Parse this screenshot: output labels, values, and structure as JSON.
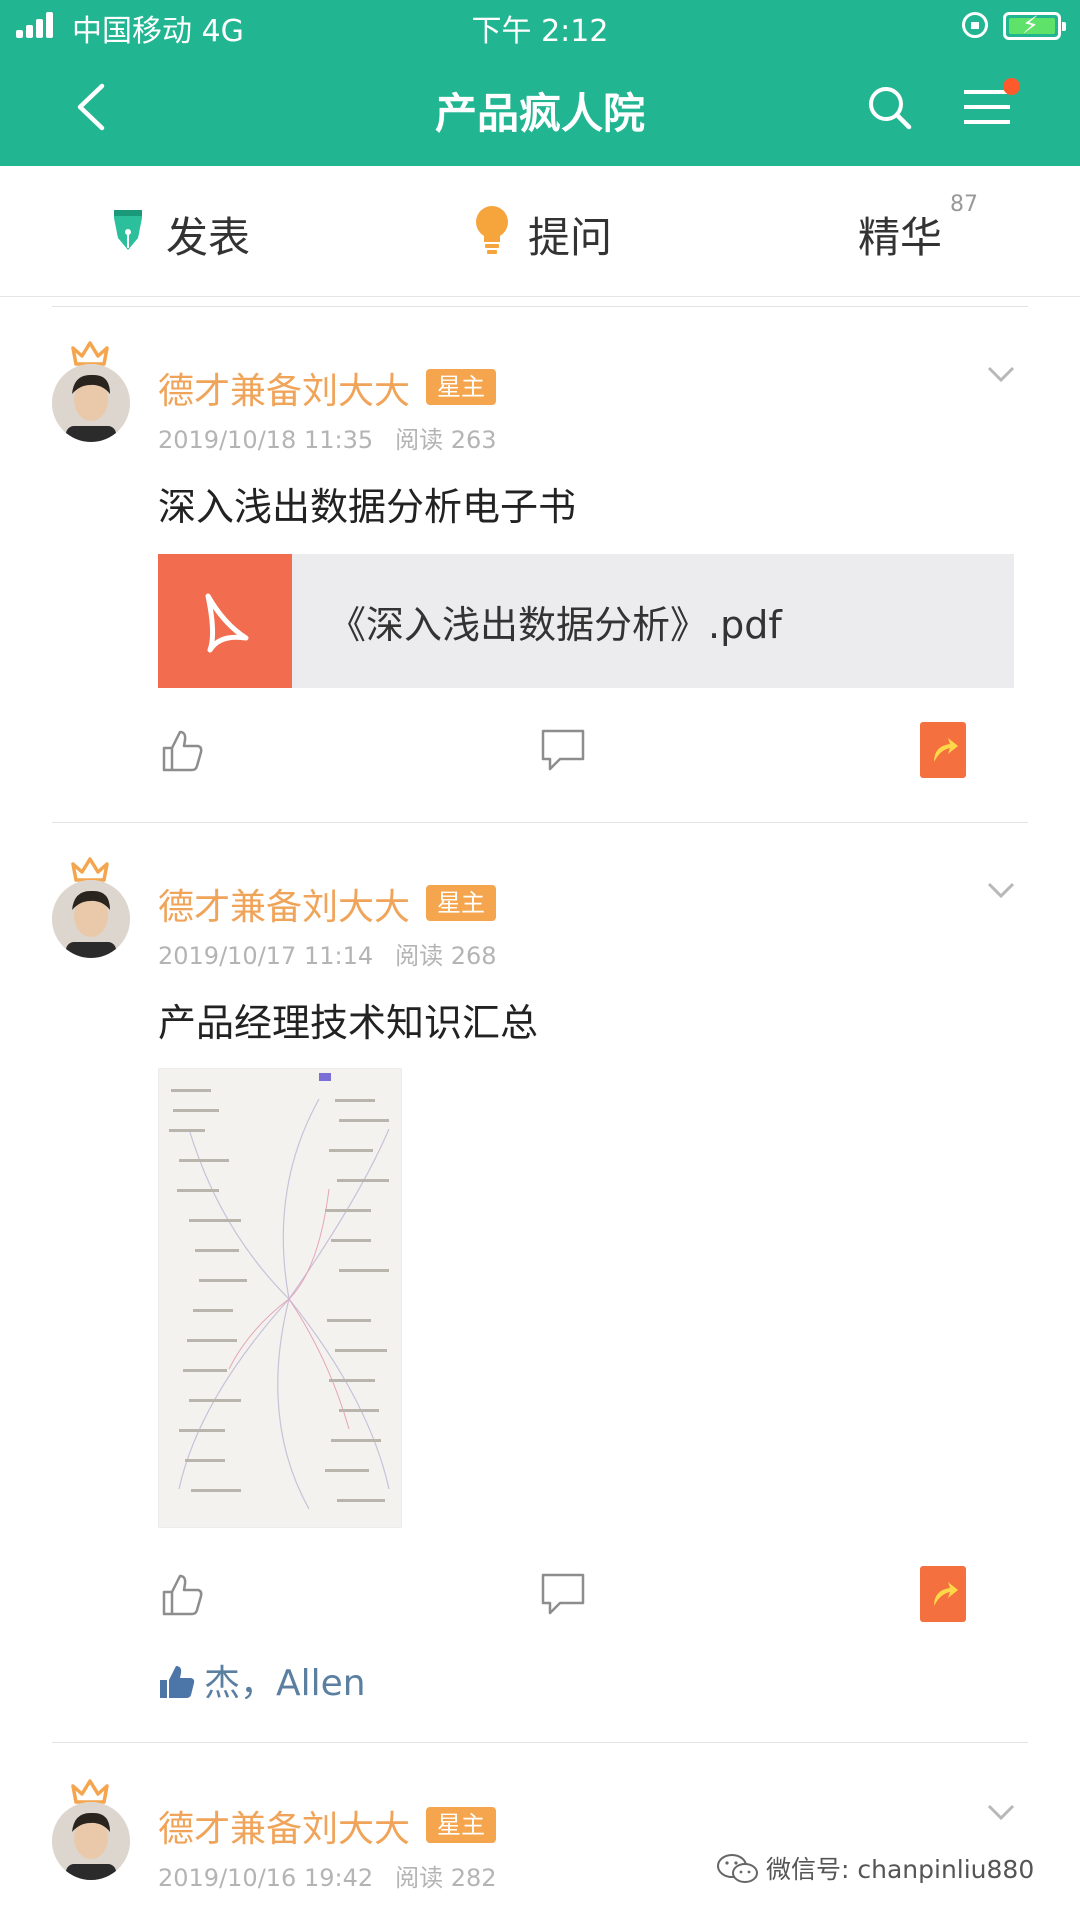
{
  "status_bar": {
    "carrier": "中国移动 4G",
    "time": "下午 2:12"
  },
  "nav": {
    "title": "产品疯人院"
  },
  "tabs": {
    "post": "发表",
    "ask": "提问",
    "best": "精华",
    "best_count": "87"
  },
  "posts": [
    {
      "author": "德才兼备刘大大",
      "badge": "星主",
      "date": "2019/10/18 11:35",
      "reads": "阅读 263",
      "title": "深入浅出数据分析电子书",
      "attachment": "《深入浅出数据分析》.pdf"
    },
    {
      "author": "德才兼备刘大大",
      "badge": "星主",
      "date": "2019/10/17 11:14",
      "reads": "阅读 268",
      "title": "产品经理技术知识汇总",
      "likers": "杰，Allen"
    },
    {
      "author": "德才兼备刘大大",
      "badge": "星主",
      "date": "2019/10/16 19:42",
      "reads": "阅读 282"
    }
  ],
  "watermark": "微信号: chanpinliu880",
  "colors": {
    "brand": "#22b591",
    "accent": "#f4a54e",
    "share": "#f4703f",
    "pdf": "#f26c4f"
  }
}
